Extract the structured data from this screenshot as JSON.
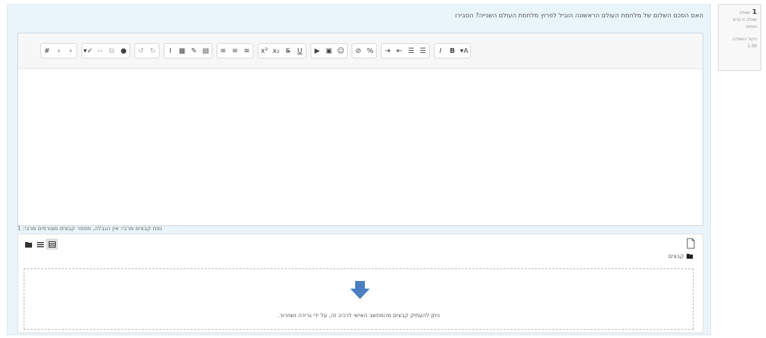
{
  "question_info": {
    "number": "1",
    "number_label": "שאלה",
    "status": [
      "שאלה זו טרם",
      "נענתה"
    ],
    "grade": [
      "ניקוד השאלה:",
      "1.00"
    ]
  },
  "question": {
    "text": "האם הסכם השלום של מלחמת העולם הראשונה הוביל לפרוץ מלחמת העולם השנייה? הסבירו"
  },
  "editor": {
    "toolbar_groups": [
      [
        {
          "icon": "html-icon",
          "glyph": "#"
        },
        {
          "icon": "undo-icon",
          "glyph": "‹"
        },
        {
          "icon": "redo-icon",
          "glyph": "›"
        }
      ],
      [
        {
          "icon": "brush-icon",
          "glyph": "▾✓"
        },
        {
          "icon": "code-icon",
          "glyph": "‹›"
        },
        {
          "icon": "copy-icon",
          "glyph": "⧉"
        },
        {
          "icon": "info-icon",
          "glyph": "●"
        }
      ],
      [
        {
          "icon": "rotate-left-icon",
          "glyph": "↺"
        },
        {
          "icon": "rotate-right-icon",
          "glyph": "↻"
        }
      ],
      [
        {
          "icon": "text-cursor-icon",
          "glyph": "I"
        },
        {
          "icon": "table-icon",
          "glyph": "▦"
        },
        {
          "icon": "edit-icon",
          "glyph": "✎"
        },
        {
          "icon": "paste-icon",
          "glyph": "▤"
        }
      ],
      [
        {
          "icon": "align-right-icon",
          "glyph": "≡"
        },
        {
          "icon": "align-center-icon",
          "glyph": "≡"
        },
        {
          "icon": "align-left-icon",
          "glyph": "≡"
        }
      ],
      [
        {
          "icon": "superscript-icon",
          "glyph": "x²"
        },
        {
          "icon": "subscript-icon",
          "glyph": "x₂"
        },
        {
          "icon": "strikethrough-icon",
          "glyph": "S"
        },
        {
          "icon": "underline-icon",
          "glyph": "U"
        }
      ],
      [
        {
          "icon": "media-icon",
          "glyph": "▶"
        },
        {
          "icon": "image-icon",
          "glyph": "▣"
        },
        {
          "icon": "emoji-icon",
          "glyph": "☺"
        }
      ],
      [
        {
          "icon": "unlink-icon",
          "glyph": "⊘"
        },
        {
          "icon": "link-icon",
          "glyph": "%"
        }
      ],
      [
        {
          "icon": "indent-icon",
          "glyph": "⇥"
        },
        {
          "icon": "outdent-icon",
          "glyph": "⇤"
        },
        {
          "icon": "numbered-list-icon",
          "glyph": "☰"
        },
        {
          "icon": "bullet-list-icon",
          "glyph": "☰"
        }
      ],
      [
        {
          "icon": "italic-icon",
          "glyph": "I"
        },
        {
          "icon": "bold-icon",
          "glyph": "B"
        },
        {
          "icon": "font-size-icon",
          "glyph": "▾A"
        }
      ]
    ]
  },
  "attachments": {
    "caption": "נפח קבצים מרבי: אין הגבלה, מספר קבצים מצורפים מרבי: 1",
    "folder_label": "קבצים",
    "drop_text": "ניתן להעתיק קבצים מהמחשב האישי לרכיב זה, על ידי גרירה ושחרור."
  },
  "colors": {
    "panel_bg": "#eaf4fb",
    "drop_arrow": "#4a7fc1"
  }
}
